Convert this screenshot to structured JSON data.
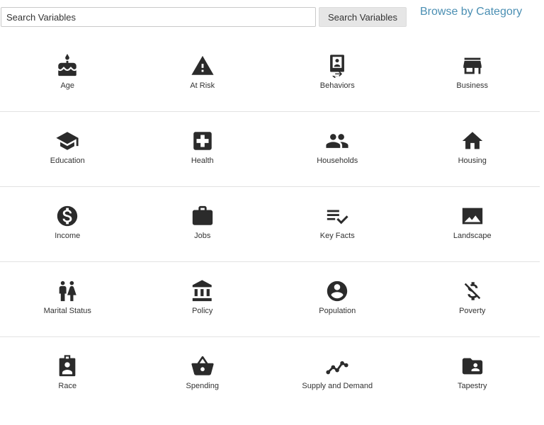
{
  "search": {
    "placeholder": "Search Variables",
    "button_label": "Search Variables"
  },
  "browse_link": "Browse by Category",
  "colors": {
    "icon": "#2b2b2b",
    "link": "#4b8fb3"
  },
  "categories": [
    {
      "label": "Age",
      "icon": "birthday-cake-icon"
    },
    {
      "label": "At Risk",
      "icon": "warning-icon"
    },
    {
      "label": "Behaviors",
      "icon": "phone-person-icon"
    },
    {
      "label": "Business",
      "icon": "store-icon"
    },
    {
      "label": "Education",
      "icon": "graduation-cap-icon"
    },
    {
      "label": "Health",
      "icon": "medical-cross-icon"
    },
    {
      "label": "Households",
      "icon": "people-icon"
    },
    {
      "label": "Housing",
      "icon": "home-icon"
    },
    {
      "label": "Income",
      "icon": "dollar-circle-icon"
    },
    {
      "label": "Jobs",
      "icon": "briefcase-icon"
    },
    {
      "label": "Key Facts",
      "icon": "checklist-icon"
    },
    {
      "label": "Landscape",
      "icon": "landscape-image-icon"
    },
    {
      "label": "Marital Status",
      "icon": "couple-icon"
    },
    {
      "label": "Policy",
      "icon": "government-building-icon"
    },
    {
      "label": "Population",
      "icon": "account-circle-icon"
    },
    {
      "label": "Poverty",
      "icon": "money-off-icon"
    },
    {
      "label": "Race",
      "icon": "badge-icon"
    },
    {
      "label": "Spending",
      "icon": "basket-icon"
    },
    {
      "label": "Supply and Demand",
      "icon": "trend-line-icon"
    },
    {
      "label": "Tapestry",
      "icon": "folder-person-icon"
    }
  ]
}
